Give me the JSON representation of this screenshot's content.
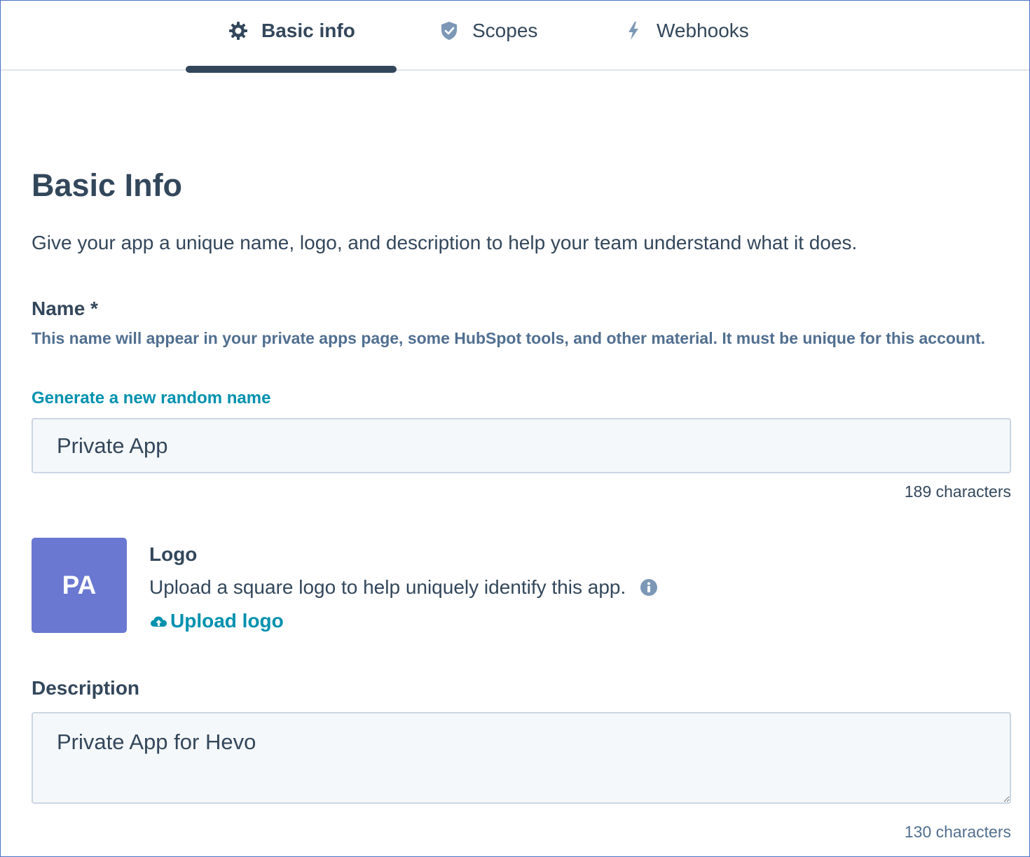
{
  "tabs": {
    "basic_info": "Basic info",
    "scopes": "Scopes",
    "webhooks": "Webhooks",
    "active": "basic_info"
  },
  "page": {
    "title": "Basic Info",
    "description": "Give your app a unique name, logo, and description to help your team understand what it does."
  },
  "name_field": {
    "label": "Name *",
    "help": "This name will appear in your private apps page, some HubSpot tools, and other material. It must be unique for this account.",
    "generate_link": "Generate a new random name",
    "value": "Private App",
    "char_count": "189 characters"
  },
  "logo": {
    "initials": "PA",
    "label": "Logo",
    "description": "Upload a square logo to help uniquely identify this app.",
    "upload_link": "Upload logo",
    "tile_color": "#6a78d1"
  },
  "description_field": {
    "label": "Description",
    "value": "Private App for Hevo",
    "char_count": "130 characters"
  },
  "colors": {
    "text": "#33475b",
    "link": "#0091ae",
    "muted": "#516f90",
    "input_bg": "#f5f8fa",
    "input_border": "#cbd6e2"
  },
  "icons": {
    "basic_info": "gear-icon",
    "scopes": "shield-icon",
    "webhooks": "lightning-icon",
    "info": "info-icon",
    "upload": "cloud-upload-icon"
  }
}
